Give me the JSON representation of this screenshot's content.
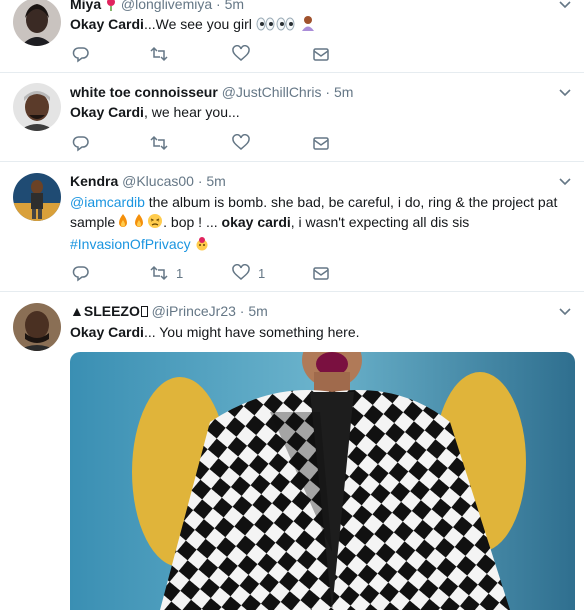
{
  "tweets": [
    {
      "name": "Miya",
      "handle": "@longlivemiya",
      "dot": "·",
      "time": "5m",
      "text_bold": "Okay Cardi",
      "text_rest": "...We see you girl",
      "reply_count": "",
      "retweet_count": "",
      "like_count": ""
    },
    {
      "name": "white toe connoisseur",
      "handle": "@JustChillChris",
      "dot": "·",
      "time": "5m",
      "text_bold": "Okay Cardi",
      "text_rest": ", we hear you...",
      "reply_count": "",
      "retweet_count": "",
      "like_count": ""
    },
    {
      "name": "Kendra",
      "handle": "@Klucas00",
      "dot": "·",
      "time": "5m",
      "mention": "@iamcardib",
      "line1_rest": " the album is bomb. she bad, be careful, i do, ring & the project pat",
      "line2_start": "sample",
      "line2_mid": ". bop !  ...  ",
      "line2_bold": "okay cardi",
      "line2_end": ", i wasn't expecting all dis sis",
      "hashtag": "#InvasionOfPrivacy",
      "reply_count": "",
      "retweet_count": "1",
      "like_count": "1"
    },
    {
      "name": "▲SLEEZO",
      "handle": "@iPrinceJr23",
      "dot": "·",
      "time": "5m",
      "text_bold": "Okay Cardi",
      "text_rest": "... You might have something here."
    }
  ],
  "icons": {
    "reply": "reply-icon",
    "retweet": "retweet-icon",
    "like": "heart-icon",
    "dm": "envelope-icon",
    "caret": "chevron-down-icon"
  },
  "colors": {
    "link": "#1b95e0",
    "muted": "#657786",
    "divider": "#e6ecf0"
  }
}
